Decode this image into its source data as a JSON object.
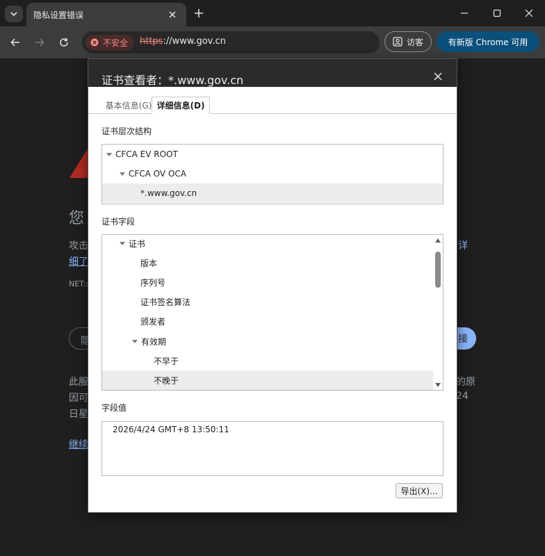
{
  "browser": {
    "tab_title": "隐私设置错误",
    "insecure_label": "不安全",
    "url_scheme": "https",
    "url_rest": "://www.gov.cn",
    "guest_label": "访客",
    "update_label": "有新版 Chrome 可用"
  },
  "background_page": {
    "line_heading": "您",
    "line1_left": "攻击",
    "line1_right": "详",
    "line2_left": "细了",
    "net_code": "NET::",
    "btn_left": "隐",
    "btn_right": "接",
    "para_line1_left": "此服",
    "para_line1_right": "的原",
    "para_line2_left": "因可",
    "para_line2_right": "24",
    "para_line3_left": "日星",
    "continue_link": "继续"
  },
  "dialog": {
    "title": "证书查看者：*.www.gov.cn",
    "tabs": [
      {
        "label": "基本信息(G)"
      },
      {
        "label": "详细信息(D)"
      }
    ],
    "hierarchy_label": "证书层次结构",
    "hierarchy": [
      {
        "label": "CFCA EV ROOT"
      },
      {
        "label": "CFCA OV OCA"
      },
      {
        "label": "*.www.gov.cn"
      }
    ],
    "fields_label": "证书字段",
    "fields": [
      {
        "label": "证书"
      },
      {
        "label": "版本"
      },
      {
        "label": "序列号"
      },
      {
        "label": "证书签名算法"
      },
      {
        "label": "颁发者"
      },
      {
        "label": "有效期"
      },
      {
        "label": "不早于"
      },
      {
        "label": "不晚于"
      }
    ],
    "value_label": "字段值",
    "field_value": "2026/4/24 GMT+8 13:50:11",
    "export_label": "导出(X)..."
  }
}
